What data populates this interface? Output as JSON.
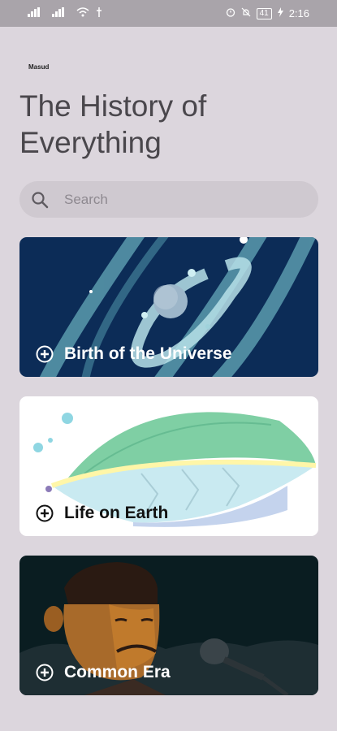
{
  "status_bar": {
    "time": "2:16",
    "battery": "41"
  },
  "brand": "Masud",
  "title": "The History of Everything",
  "search": {
    "placeholder": "Search"
  },
  "cards": [
    {
      "label": "Birth of the Universe",
      "bg": "#0C2C57",
      "text_color": "#FFFFFF"
    },
    {
      "label": "Life on Earth",
      "bg": "#FFFFFF",
      "text_color": "#111111"
    },
    {
      "label": "Common Era",
      "bg": "#0A1D21",
      "text_color": "#FFFFFF"
    }
  ]
}
